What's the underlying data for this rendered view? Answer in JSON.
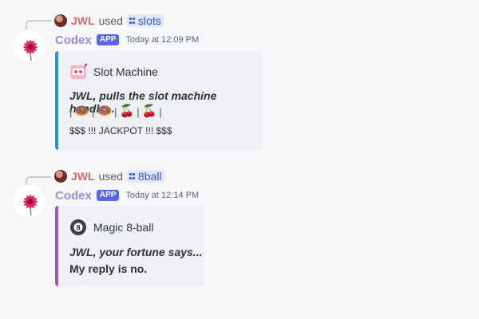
{
  "messages": [
    {
      "reply": {
        "user": "JWL",
        "used": "used",
        "command": "slots"
      },
      "author": "Codex",
      "badge": "APP",
      "timestamp": "Today at 12:09 PM",
      "embed": {
        "color": "#2d8fd4",
        "author_icon": "slot-machine-icon",
        "author_name": "Slot Machine",
        "title": "JWL, pulls the slot machine handle...",
        "reels": [
          "🍩",
          "🍩",
          "🍒",
          "🍒"
        ],
        "result": "$$$ !!! JACKPOT !!! $$$"
      }
    },
    {
      "reply": {
        "user": "JWL",
        "used": "used",
        "command": "8ball"
      },
      "author": "Codex",
      "badge": "APP",
      "timestamp": "Today at 12:14 PM",
      "embed": {
        "color": "#9b59b6",
        "author_icon": "magic-8-ball-icon",
        "author_name": "Magic 8-ball",
        "title": "JWL, your fortune says...",
        "answer": "My reply is no."
      }
    }
  ]
}
